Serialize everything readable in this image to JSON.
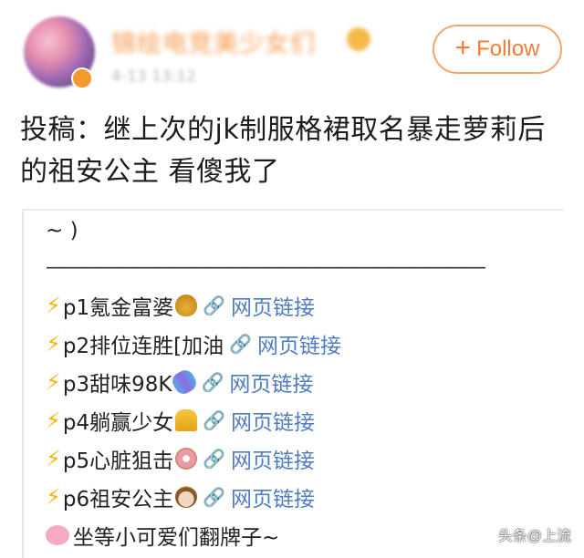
{
  "header": {
    "username": "锦绘电竞美少女们",
    "timestamp": "4-13 13:12",
    "follow_label": "Follow",
    "follow_plus": "+"
  },
  "post": {
    "text": "投稿：继上次的jk制服格裙取名暴走萝莉后的祖安公主 看傻我了"
  },
  "quote": {
    "line_top": "~ )",
    "divider": "————————————————————————",
    "items": [
      {
        "bolt": "⚡",
        "label": "p1氪金富婆",
        "emoji": "money-bag",
        "link_icon": "🔗",
        "link_text": "网页链接"
      },
      {
        "bolt": "⚡",
        "label": "p2排位连胜[加油",
        "emoji": "",
        "link_icon": "🔗",
        "link_text": "网页链接"
      },
      {
        "bolt": "⚡",
        "label": "p3甜味98K",
        "emoji": "candy",
        "link_icon": "🔗",
        "link_text": "网页链接"
      },
      {
        "bolt": "⚡",
        "label": "p4躺赢少女",
        "emoji": "bell",
        "link_icon": "🔗",
        "link_text": "网页链接"
      },
      {
        "bolt": "⚡",
        "label": "p5心脏狙击",
        "emoji": "donut",
        "link_icon": "🔗",
        "link_text": "网页链接"
      },
      {
        "bolt": "⚡",
        "label": "p6祖安公主",
        "emoji": "princess",
        "link_icon": "🔗",
        "link_text": "网页链接"
      }
    ],
    "closing": "坐等小可爱们翻牌子~"
  },
  "watermark": "头条@上流",
  "colors": {
    "accent": "#ee7d3a",
    "link": "#4f7cbf",
    "bolt": "#f5b400"
  }
}
